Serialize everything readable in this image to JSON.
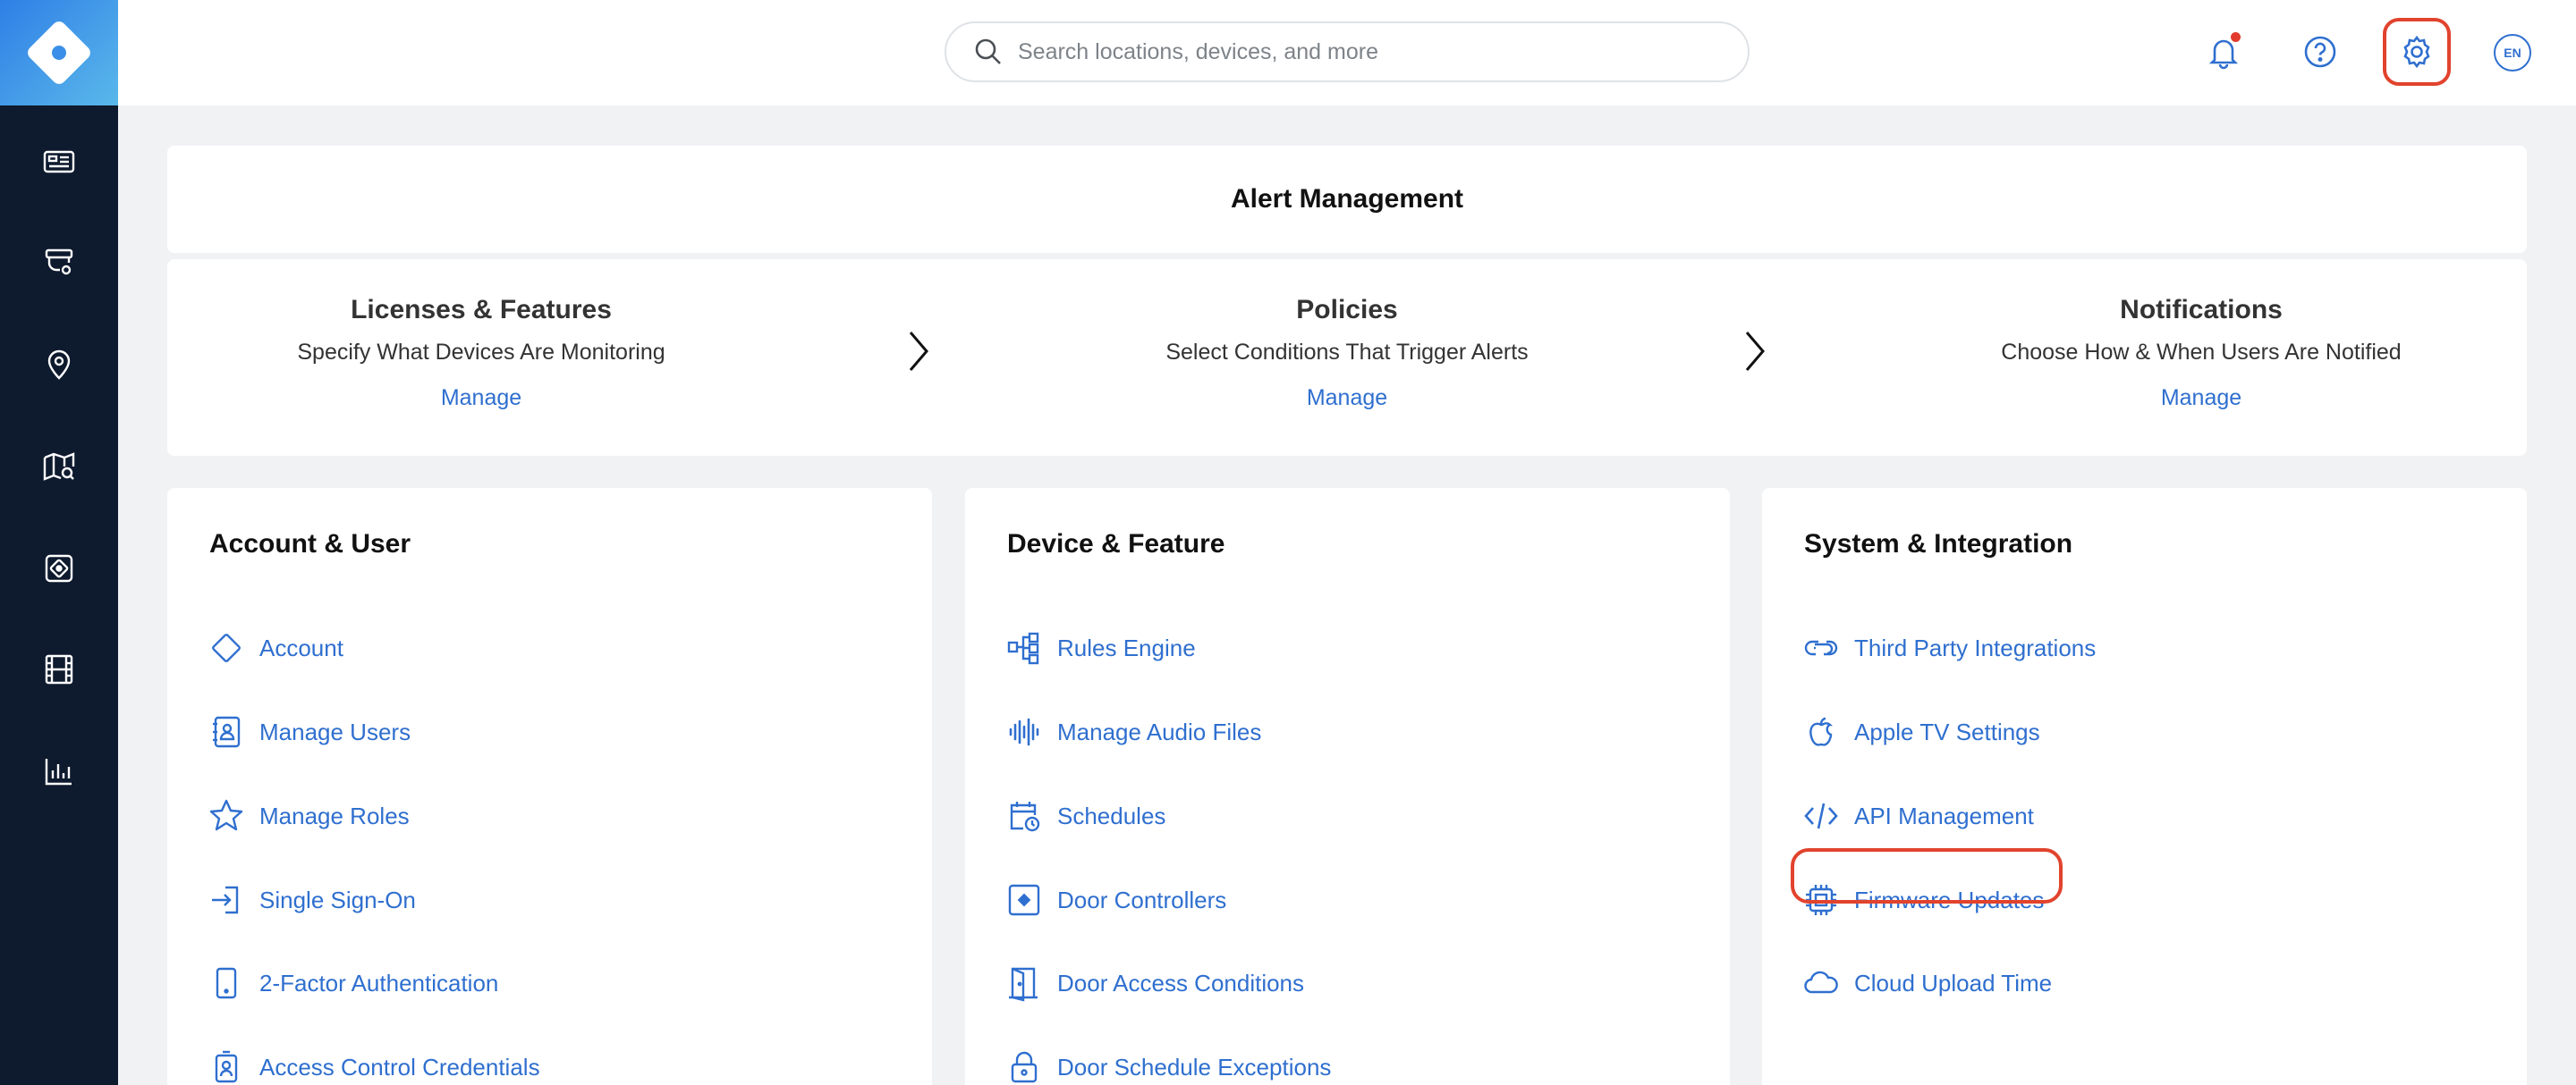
{
  "topbar": {
    "search_placeholder": "Search locations, devices, and more",
    "language": "EN"
  },
  "alert_management": {
    "title": "Alert Management",
    "steps": [
      {
        "title": "Licenses & Features",
        "subtitle": "Specify What Devices Are Monitoring",
        "link": "Manage"
      },
      {
        "title": "Policies",
        "subtitle": "Select Conditions That Trigger Alerts",
        "link": "Manage"
      },
      {
        "title": "Notifications",
        "subtitle": "Choose How & When Users Are Notified",
        "link": "Manage"
      }
    ]
  },
  "sections": [
    {
      "title": "Account & User",
      "items": [
        {
          "label": "Account",
          "icon": "diamond-icon"
        },
        {
          "label": "Manage Users",
          "icon": "user-book-icon"
        },
        {
          "label": "Manage Roles",
          "icon": "star-icon"
        },
        {
          "label": "Single Sign-On",
          "icon": "sign-in-icon"
        },
        {
          "label": "2-Factor Authentication",
          "icon": "phone-icon"
        },
        {
          "label": "Access Control Credentials",
          "icon": "badge-icon"
        }
      ]
    },
    {
      "title": "Device & Feature",
      "items": [
        {
          "label": "Rules Engine",
          "icon": "rules-icon"
        },
        {
          "label": "Manage Audio Files",
          "icon": "audio-wave-icon"
        },
        {
          "label": "Schedules",
          "icon": "calendar-clock-icon"
        },
        {
          "label": "Door Controllers",
          "icon": "controller-icon"
        },
        {
          "label": "Door Access Conditions",
          "icon": "door-icon"
        },
        {
          "label": "Door Schedule Exceptions",
          "icon": "lock-icon"
        }
      ]
    },
    {
      "title": "System & Integration",
      "items": [
        {
          "label": "Third Party Integrations",
          "icon": "link-icon"
        },
        {
          "label": "Apple TV Settings",
          "icon": "apple-icon"
        },
        {
          "label": "API Management",
          "icon": "code-icon"
        },
        {
          "label": "Firmware Updates",
          "icon": "chip-icon"
        },
        {
          "label": "Cloud Upload Time",
          "icon": "cloud-icon"
        }
      ]
    }
  ],
  "colors": {
    "sidebar": "#0e1a2e",
    "accent": "#2f6fcf",
    "highlight": "#e1432d"
  }
}
